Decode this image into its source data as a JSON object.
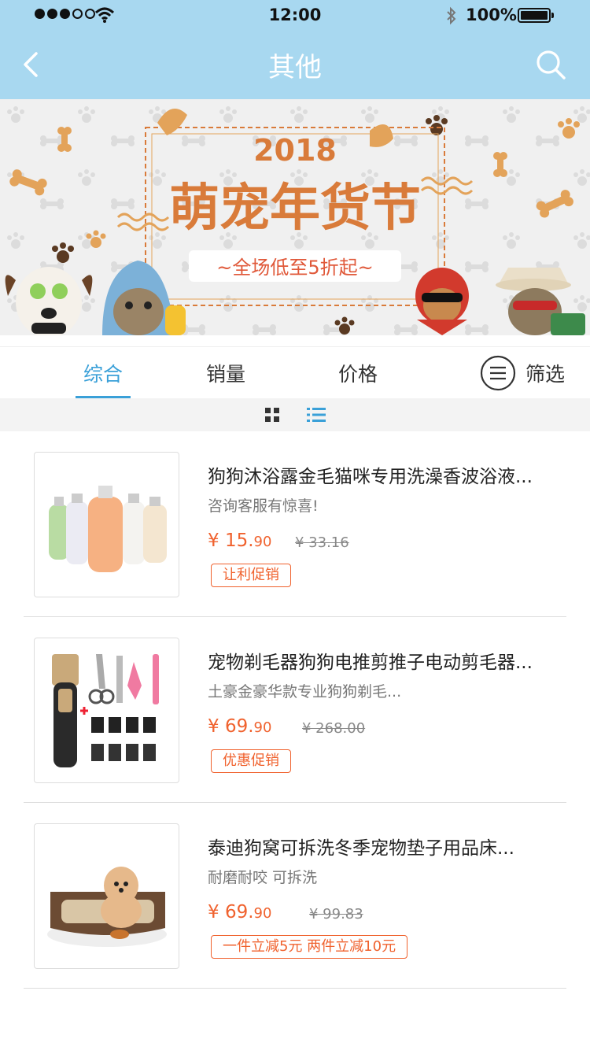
{
  "status_bar": {
    "time": "12:00",
    "battery": "100%"
  },
  "nav": {
    "title": "其他"
  },
  "banner": {
    "year": "2018",
    "headline": "萌宠年货节",
    "slogan": "~全场低至5折起~"
  },
  "sort_tabs": [
    {
      "label": "综合",
      "active": true
    },
    {
      "label": "销量",
      "active": false
    },
    {
      "label": "价格",
      "active": false
    }
  ],
  "filter": {
    "label": "筛选"
  },
  "view_mode": "list",
  "colors": {
    "header_bg": "#a8d8f0",
    "accent": "#3aa0d8",
    "price": "#f0622e"
  },
  "products": [
    {
      "title": "狗狗沐浴露金毛猫咪专用洗澡香波浴液...",
      "subtitle": "咨询客服有惊喜!",
      "price_int": "¥ 15.",
      "price_dec": "90",
      "old_price": "¥ 33.16",
      "tag": "让利促销"
    },
    {
      "title": "宠物剃毛器狗狗电推剪推子电动剪毛器...",
      "subtitle": "土豪金豪华款专业狗狗剃毛...",
      "price_int": "¥ 69.",
      "price_dec": "90",
      "old_price": "¥ 268.00",
      "tag": "优惠促销"
    },
    {
      "title": "泰迪狗窝可拆洗冬季宠物垫子用品床...",
      "subtitle": "耐磨耐咬  可拆洗",
      "price_int": "¥ 69.",
      "price_dec": "90",
      "old_price": "¥ 99.83",
      "tag": "一件立减5元  两件立减10元"
    }
  ]
}
